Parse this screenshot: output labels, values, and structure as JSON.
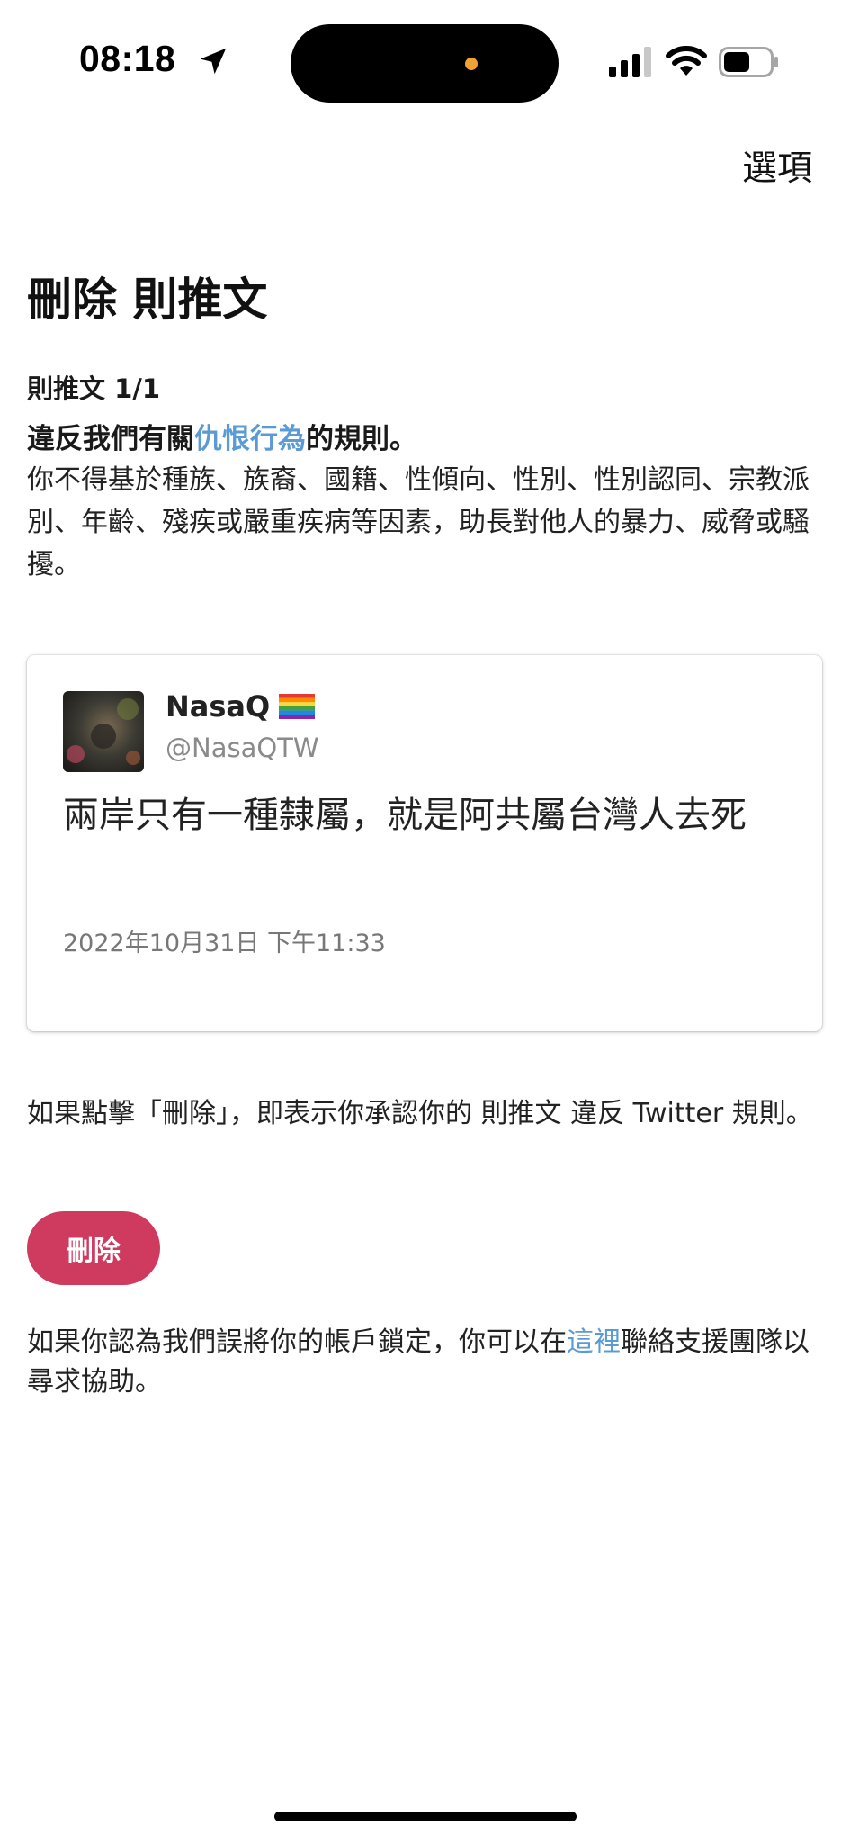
{
  "status_bar": {
    "time": "08:18",
    "icons": [
      "location-arrow-icon",
      "signal-icon",
      "wifi-icon",
      "battery-icon"
    ]
  },
  "header": {
    "options_label": "選項"
  },
  "page": {
    "title": "刪除 則推文",
    "counter": "則推文 1/1",
    "rule_prefix": "違反我們有關",
    "rule_link": "仇恨行為",
    "rule_suffix": "的規則。",
    "rule_description": "你不得基於種族、族裔、國籍、性傾向、性別、性別認同、宗教派別、年齡、殘疾或嚴重疾病等因素，助長對他人的暴力、威脅或騷擾。"
  },
  "tweet": {
    "author_name": "NasaQ",
    "author_flag": "rainbow-flag-icon",
    "author_handle": "@NasaQTW",
    "text": "兩岸只有一種隸屬，就是阿共屬台灣人去死",
    "timestamp": "2022年10月31日 下午11:33"
  },
  "confirm": {
    "text": "如果點擊「刪除」，即表示你承認你的 則推文 違反 Twitter 規則。",
    "delete_label": "刪除"
  },
  "support": {
    "prefix": "如果你認為我們誤將你的帳戶鎖定，你可以在",
    "link": "這裡",
    "suffix": "聯絡支援團隊以尋求協助。"
  },
  "colors": {
    "link": "#5b9bd5",
    "delete_button": "#cf3a5f",
    "island_dot": "#f0a233"
  }
}
